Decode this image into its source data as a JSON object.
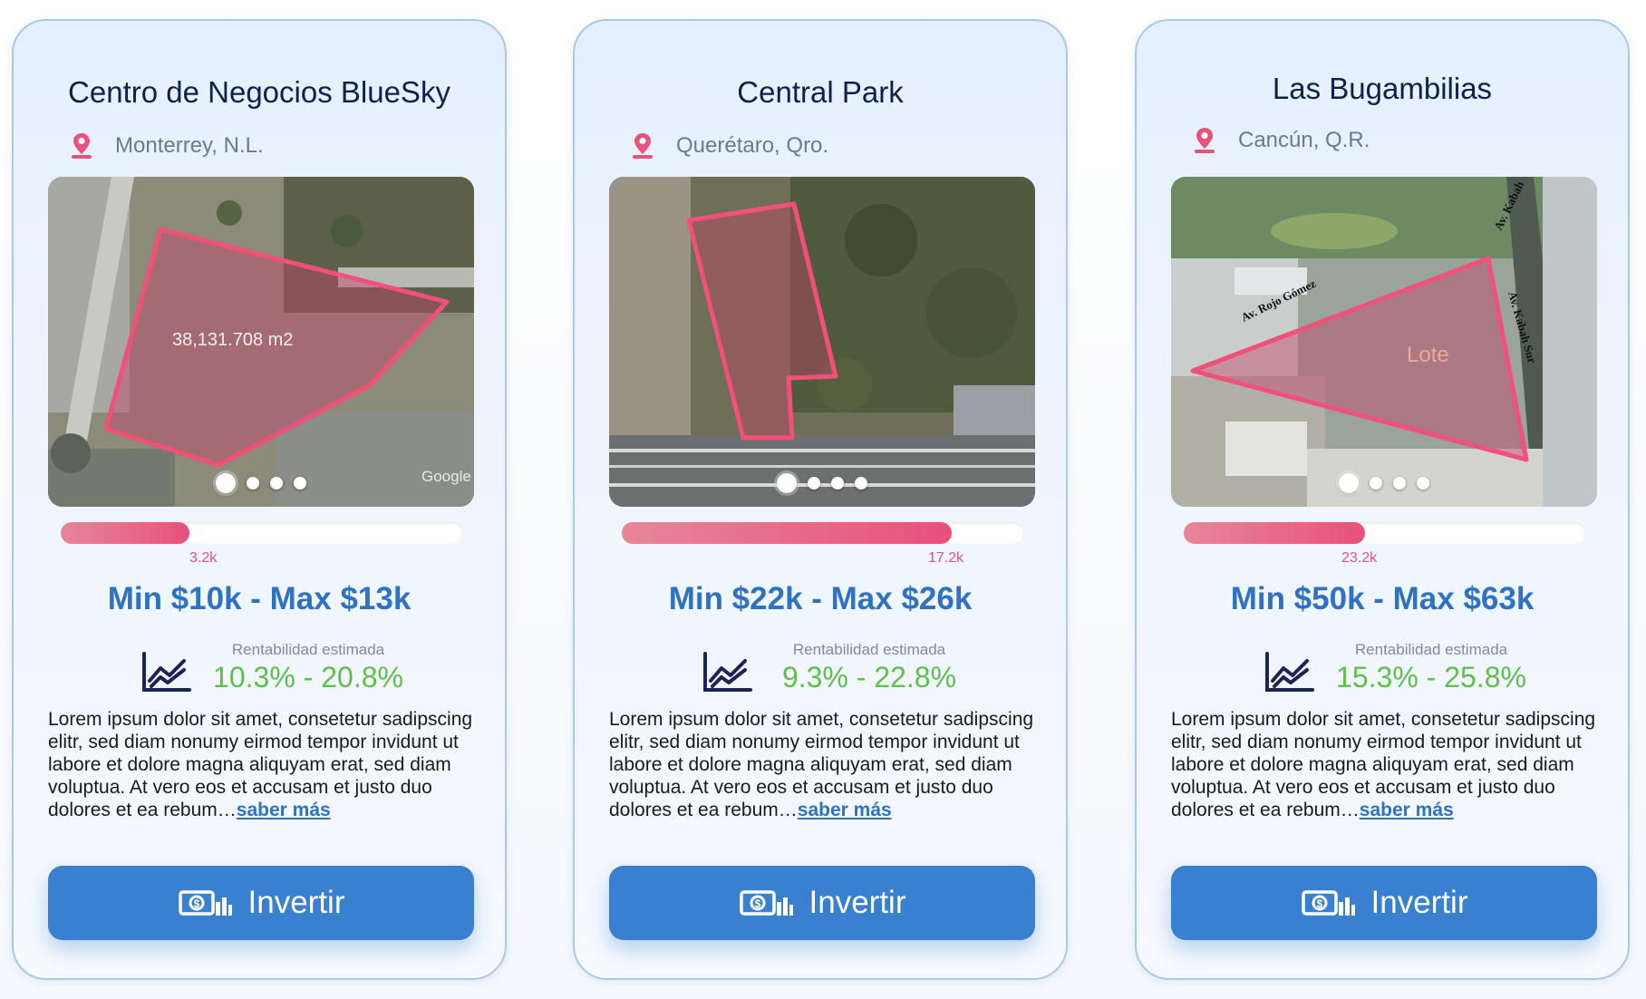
{
  "colors": {
    "accent_blue": "#3a80d0",
    "price_blue": "#2f72c2",
    "title_navy": "#10204e",
    "pink": "#e8517a",
    "green": "#5fbe4d"
  },
  "cards": [
    {
      "title": "Centro de Negocios BlueSky",
      "location": "Monterrey, N.L.",
      "photo_overlay_label": "38,131.708 m2",
      "photo_watermark": "Google",
      "carousel_dots": 4,
      "carousel_active": 0,
      "progress_fraction": 0.32,
      "progress_label": "3.2k",
      "price_range": "Min $10k - Max $13k",
      "rentability_label": "Rentabilidad estimada",
      "rentability_value": "10.3% - 20.8%",
      "description": "Lorem ipsum dolor sit amet, consetetur sadipscing elitr, sed diam nonumy eirmod tempor invidunt ut labore et dolore magna aliquyam erat, sed diam voluptua. At vero eos et accusam et justo duo dolores et ea rebum…",
      "more_link": "saber más",
      "button_label": "Invertir",
      "icons": {
        "location": "location-pin-icon",
        "rentability": "chart-trend-icon",
        "button": "money-bills-icon"
      }
    },
    {
      "title": "Central Park",
      "location": "Querétaro, Qro.",
      "photo_overlay_label": "",
      "photo_watermark": "",
      "carousel_dots": 4,
      "carousel_active": 0,
      "progress_fraction": 0.82,
      "progress_label": "17.2k",
      "price_range": "Min $22k - Max $26k",
      "rentability_label": "Rentabilidad estimada",
      "rentability_value": "9.3% - 22.8%",
      "description": "Lorem ipsum dolor sit amet, consetetur sadipscing elitr, sed diam nonumy eirmod tempor invidunt ut labore et dolore magna aliquyam erat, sed diam voluptua. At vero eos et accusam et justo duo dolores et ea rebum…",
      "more_link": "saber más",
      "button_label": "Invertir",
      "icons": {
        "location": "location-pin-icon",
        "rentability": "chart-trend-icon",
        "button": "money-bills-icon"
      }
    },
    {
      "title": "Las Bugambilias",
      "location": "Cancún, Q.R.",
      "photo_overlay_label": "Lote",
      "photo_street_labels": [
        "Av. Rojo Gómez",
        "Av. Kabah",
        "Av. Kabah Sur"
      ],
      "carousel_dots": 4,
      "carousel_active": 0,
      "progress_fraction": 0.45,
      "progress_label": "23.2k",
      "price_range": "Min $50k - Max $63k",
      "rentability_label": "Rentabilidad estimada",
      "rentability_value": "15.3% - 25.8%",
      "description": "Lorem ipsum dolor sit amet, consetetur sadipscing elitr, sed diam nonumy eirmod tempor invidunt ut labore et dolore magna aliquyam erat, sed diam voluptua. At vero eos et accusam et justo duo dolores et ea rebum…",
      "more_link": "saber más",
      "button_label": "Invertir",
      "icons": {
        "location": "location-pin-icon",
        "rentability": "chart-trend-icon",
        "button": "money-bills-icon"
      }
    }
  ]
}
